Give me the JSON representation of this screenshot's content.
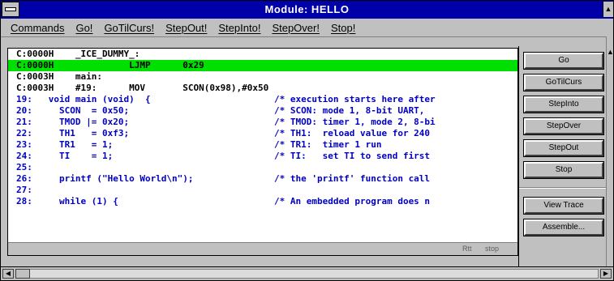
{
  "window": {
    "title": "Module: HELLO"
  },
  "menu": {
    "items": [
      {
        "label": "Commands"
      },
      {
        "label": "Go!"
      },
      {
        "label": "GoTilCurs!"
      },
      {
        "label": "StepOut!"
      },
      {
        "label": "StepInto!"
      },
      {
        "label": "StepOver!"
      },
      {
        "label": "Stop!"
      }
    ]
  },
  "code": {
    "lines": [
      {
        "text": "C:0000H    _ICE_DUMMY_:",
        "comment": "",
        "style": "plain"
      },
      {
        "text": "C:0000H              LJMP      0x29",
        "comment": "",
        "style": "highlight"
      },
      {
        "text": "C:0003H    main:",
        "comment": "",
        "style": "plain"
      },
      {
        "text": "C:0003H    #19:      MOV       SCON(0x98),#0x50",
        "comment": "",
        "style": "plain"
      },
      {
        "text": "19:   void main (void)  {",
        "comment": "/* execution starts here after",
        "style": "source"
      },
      {
        "text": "20:     SCON  = 0x50;",
        "comment": "/* SCON: mode 1, 8-bit UART, ",
        "style": "source"
      },
      {
        "text": "21:     TMOD |= 0x20;",
        "comment": "/* TMOD: timer 1, mode 2, 8-bi",
        "style": "source"
      },
      {
        "text": "22:     TH1   = 0xf3;",
        "comment": "/* TH1:  reload value for 240",
        "style": "source"
      },
      {
        "text": "23:     TR1   = 1;",
        "comment": "/* TR1:  timer 1 run",
        "style": "source"
      },
      {
        "text": "24:     TI    = 1;",
        "comment": "/* TI:   set TI to send first",
        "style": "source"
      },
      {
        "text": "25:",
        "comment": "",
        "style": "source"
      },
      {
        "text": "26:     printf (\"Hello World\\n\");",
        "comment": "/* the 'printf' function call",
        "style": "source"
      },
      {
        "text": "27:",
        "comment": "",
        "style": "source"
      },
      {
        "text": "28:     while (1) {",
        "comment": "/* An embedded program does n",
        "style": "source"
      }
    ]
  },
  "status": {
    "field1": "Rtt",
    "field2": "stop"
  },
  "panel": {
    "buttons": [
      {
        "label": "Go"
      },
      {
        "label": "GoTilCurs"
      },
      {
        "label": "StepInto"
      },
      {
        "label": "StepOver"
      },
      {
        "label": "StepOut"
      },
      {
        "label": "Stop"
      },
      {
        "label": "View Trace"
      },
      {
        "label": "Assemble..."
      }
    ]
  },
  "colors": {
    "title_bar": "#0000a8",
    "highlight_line": "#00e000",
    "source_text": "#0000c0"
  }
}
